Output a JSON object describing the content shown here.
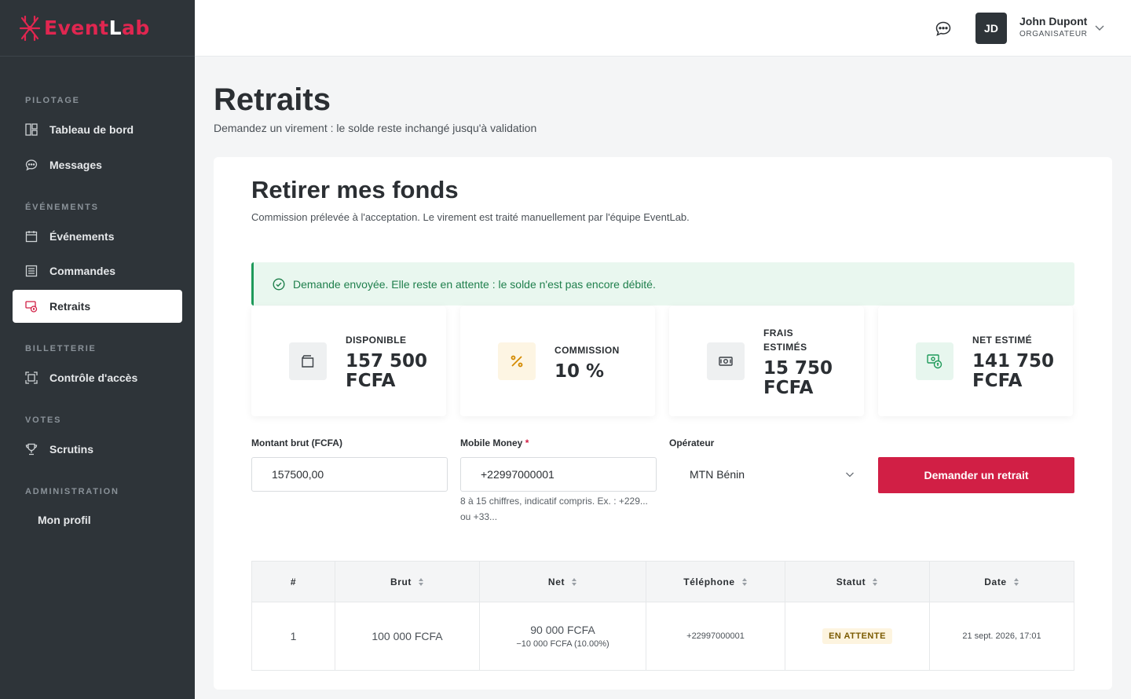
{
  "brand": {
    "name_part1": "Event",
    "name_part2": "L",
    "name_part3": "ab",
    "accent": "#e02650"
  },
  "sidebar": {
    "sections": [
      {
        "title": "PILOTAGE"
      },
      {
        "title": "ÉVÉNEMENTS"
      },
      {
        "title": "BILLETTERIE"
      },
      {
        "title": "VOTES"
      },
      {
        "title": "ADMINISTRATION"
      }
    ],
    "items": [
      {
        "label": "Tableau de bord",
        "icon": "dashboard-icon"
      },
      {
        "label": "Messages",
        "icon": "chat-icon"
      },
      {
        "label": "Événements",
        "icon": "calendar-icon"
      },
      {
        "label": "Commandes",
        "icon": "list-icon"
      },
      {
        "label": "Retraits",
        "icon": "withdraw-icon",
        "active": true
      },
      {
        "label": "Contrôle d'accès",
        "icon": "scan-icon"
      },
      {
        "label": "Scrutins",
        "icon": "trophy-icon"
      },
      {
        "label": "Mon profil"
      }
    ]
  },
  "topbar": {
    "user_initials": "JD",
    "user_name": "John Dupont",
    "user_role": "ORGANISATEUR"
  },
  "page": {
    "title": "Retraits",
    "subtitle": "Demandez un virement : le solde reste inchangé jusqu'à validation"
  },
  "card": {
    "title": "Retirer mes fonds",
    "subtitle": "Commission prélevée à l'acceptation. Le virement est traité manuellement par l'équipe EventLab.",
    "alert": "Demande envoyée. Elle reste en attente : le solde n'est pas encore débité.",
    "stats": [
      {
        "label": "DISPONIBLE",
        "value_line1": "157 500",
        "value_line2": "FCFA",
        "icon": "wallet-icon",
        "color": "#eef0f1"
      },
      {
        "label": "COMMISSION",
        "value_line1": "10 %",
        "value_line2": "",
        "icon": "percent-icon",
        "color": "#fdf5e3"
      },
      {
        "label_line1": "FRAIS",
        "label_line2": "ESTIMÉS",
        "value_line1": "15 750",
        "value_line2": "FCFA",
        "icon": "cash-icon",
        "color": "#eef0f1"
      },
      {
        "label": "NET ESTIMÉ",
        "value_line1": "141 750",
        "value_line2": "FCFA",
        "icon": "money-transfer-icon",
        "color": "#e7f6ee"
      }
    ],
    "form": {
      "amount_label": "Montant brut (FCFA)",
      "amount_value": "157500,00",
      "phone_label": "Mobile Money",
      "phone_required": "*",
      "phone_value": "+22997000001",
      "phone_hint": "8 à 15 chiffres, indicatif compris. Ex. : +229... ou +33...",
      "operator_label": "Opérateur",
      "operator_value": "MTN Bénin",
      "submit_label": "Demander un retrait"
    },
    "table": {
      "headers": [
        "#",
        "Brut",
        "Net",
        "Téléphone",
        "Statut",
        "Date"
      ],
      "rows": [
        {
          "num": "1",
          "brut": "100 000 FCFA",
          "net": "90 000 FCFA",
          "net_detail": "−10 000 FCFA (10.00%)",
          "phone": "+22997000001",
          "status": "EN ATTENTE",
          "date": "21 sept. 2026, 17:01"
        }
      ]
    }
  }
}
